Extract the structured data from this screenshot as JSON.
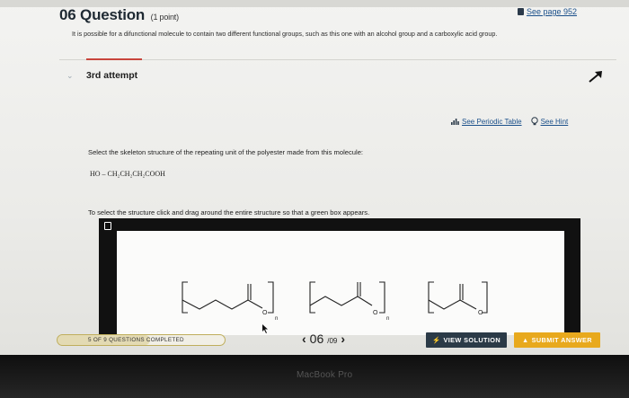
{
  "question": {
    "number": "06",
    "title": "Question",
    "points": "(1 point)",
    "see_page": "See page 952",
    "prompt": "It is possible for a difunctional molecule to contain two different functional groups, such as this one with an alcohol group and a carboxylic acid group."
  },
  "attempt": {
    "label": "3rd attempt"
  },
  "tools": {
    "periodic_table": "See Periodic Table",
    "hint": "See Hint"
  },
  "body": {
    "select_instruction": "Select the skeleton structure of the repeating unit of the polyester made from this molecule:",
    "formula": "HO – CH₂CH₂CH₂COOH",
    "drag_instruction": "To select the structure click and drag around the entire structure so that a green box appears."
  },
  "structures": {
    "subscript": "n",
    "carbonyl_o": "O"
  },
  "footer": {
    "progress_label": "5 OF 9 QUESTIONS COMPLETED",
    "progress_fraction": 0.5556,
    "page_current": "06",
    "page_total": "/09",
    "view_solution": "VIEW SOLUTION",
    "submit_answer": "SUBMIT ANSWER"
  },
  "device": {
    "brand": "MacBook Pro"
  },
  "colors": {
    "accent_red": "#c8453c",
    "submit": "#e8a91d",
    "view": "#2b3a47",
    "link": "#1a4f8a"
  }
}
